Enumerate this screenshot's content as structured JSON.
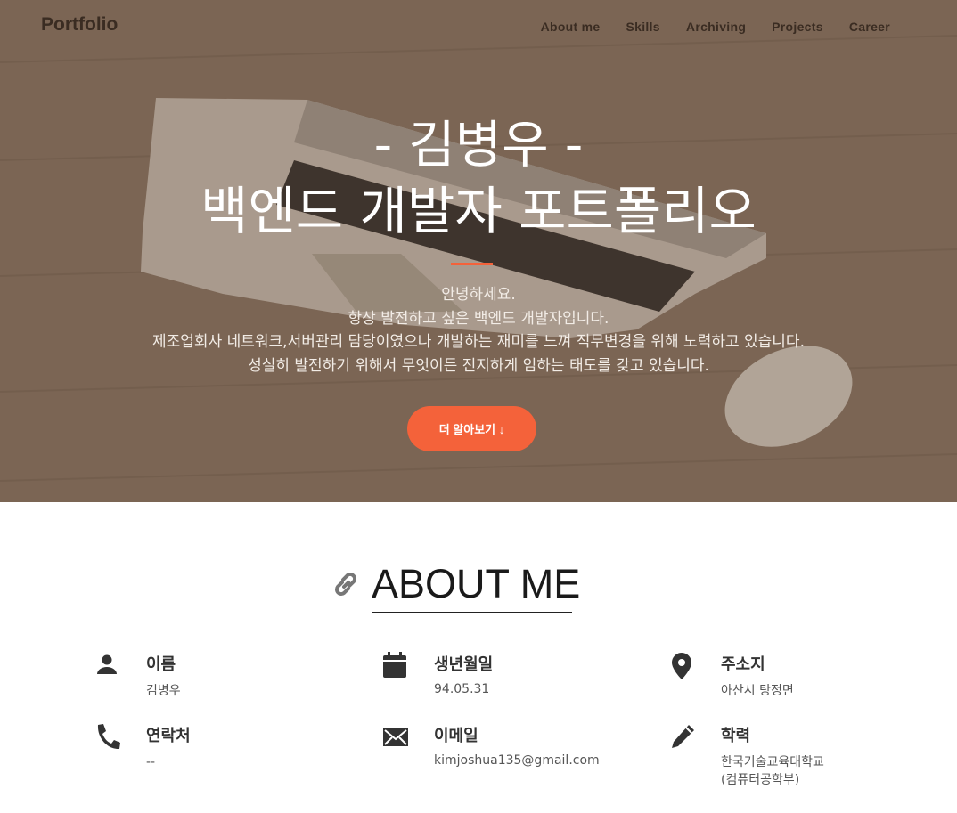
{
  "nav": {
    "brand": "Portfolio",
    "links": [
      "About me",
      "Skills",
      "Archiving",
      "Projects",
      "Career"
    ]
  },
  "hero": {
    "title_line1": "- 김병우 -",
    "title_line2": "백엔드 개발자 포트폴리오",
    "intro": [
      "안녕하세요.",
      "항상 발전하고 싶은 백엔드 개발자입니다.",
      "제조업회사 네트워크,서버관리 담당이였으나 개발하는 재미를 느껴 직무변경을 위해 노력하고 있습니다.",
      "성실히 발전하기 위해서 무엇이든 진지하게 임하는 태도를 갖고 있습니다."
    ],
    "cta_label": "더 알아보기 ↓"
  },
  "about": {
    "title": "ABOUT ME",
    "items": [
      {
        "icon": "person-icon",
        "label": "이름",
        "value": "김병우"
      },
      {
        "icon": "calendar-icon",
        "label": "생년월일",
        "value": "94.05.31"
      },
      {
        "icon": "location-pin-icon",
        "label": "주소지",
        "value": "아산시 탕정면"
      },
      {
        "icon": "phone-icon",
        "label": "연락처",
        "value": "--"
      },
      {
        "icon": "envelope-icon",
        "label": "이메일",
        "value": "kimjoshua135@gmail.com"
      },
      {
        "icon": "pencil-icon",
        "label": "학력",
        "value": "한국기술교육대학교",
        "value2": "(컴퓨터공학부)"
      }
    ]
  },
  "colors": {
    "accent": "#f4623a",
    "hero_overlay": "#7a6453"
  }
}
